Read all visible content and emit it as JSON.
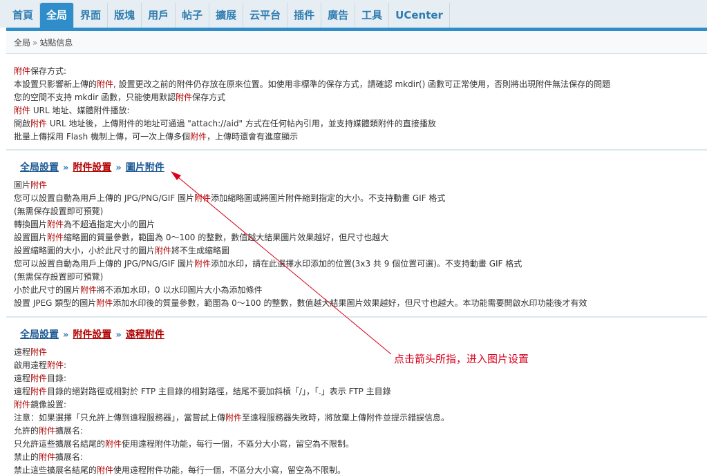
{
  "nav": {
    "tabs": [
      "首頁",
      "全局",
      "界面",
      "版塊",
      "用戶",
      "帖子",
      "擴展",
      "云平台",
      "插件",
      "廣告",
      "工具",
      "UCenter"
    ],
    "active": "全局"
  },
  "breadcrumb": {
    "root": "全局",
    "sep": "»",
    "current": "站點信息"
  },
  "colors": {
    "accent": "#2f8ec9",
    "highlight": "#b00000",
    "annotation": "#d9001b",
    "link": "#1d5a94"
  },
  "top_lines": {
    "l1": {
      "a": "附件",
      "b": "保存方式:"
    },
    "l2": {
      "a": "本設置只影響新上傳的",
      "b": "附件",
      "c": ", 設置更改之前的附件仍存放在原來位置。如使用非標準的保存方式，請確認 mkdir() 函數可正常使用，否則將出現附件無法保存的問題"
    },
    "l3": {
      "a": "您的空間不支持 mkdir 函數，只能使用默認",
      "b": "附件",
      "c": "保存方式"
    },
    "l4": {
      "a": "附件",
      "b": " URL 地址、媒體附件播放:"
    },
    "l5": {
      "a": "開啟",
      "b": "附件",
      "c": " URL 地址後，上傳附件的地址可通過 \"attach://aid\" 方式在任何帖內引用，並支持媒體類附件的直接播放"
    },
    "l6": {
      "a": "批量上傳採用 Flash 機制上傳，可一次上傳多個",
      "b": "附件",
      "c": "，上傳時還會有進度顯示"
    }
  },
  "section_image": {
    "crumb1": "全局設置",
    "crumb2": "附件設置",
    "crumb3": "圖片附件",
    "l1": {
      "a": "圖片",
      "b": "附件"
    },
    "l2": {
      "a": "您可以設置自動為用戶上傳的 JPG/PNG/GIF 圖片",
      "b": "附件",
      "c": "添加縮略圖或將圖片附件縮到指定的大小。不支持動畫 GIF 格式"
    },
    "l3": "(無需保存設置即可預覽)",
    "l4": {
      "a": "轉換圖片",
      "b": "附件",
      "c": "為不超過指定大小的圖片"
    },
    "l5": {
      "a": "設置圖片",
      "b": "附件",
      "c": "縮略圖的質量參數，範圍為 0～100 的整數，數值越大結果圖片效果越好，但尺寸也越大"
    },
    "l6": {
      "a": "設置縮略圖的大小，小於此尺寸的圖片",
      "b": "附件",
      "c": "將不生成縮略圖"
    },
    "l7": {
      "a": "您可以設置自動為用戶上傳的 JPG/PNG/GIF 圖片",
      "b": "附件",
      "c": "添加水印，請在此選擇水印添加的位置(3x3 共 9 個位置可選)。不支持動畫 GIF 格式"
    },
    "l8": "(無需保存設置即可預覽)",
    "l9": {
      "a": "小於此尺寸的圖片",
      "b": "附件",
      "c": "將不添加水印，0 以水印圖片大小為添加條件"
    },
    "l10": {
      "a": "設置 JPEG 類型的圖片",
      "b": "附件",
      "c": "添加水印後的質量參數，範圍為 0～100 的整數，數值越大結果圖片效果越好，但尺寸也越大。本功能需要開啟水印功能後才有效"
    }
  },
  "section_remote": {
    "crumb1": "全局設置",
    "crumb2": "附件設置",
    "crumb3": "遠程附件",
    "l1": {
      "a": "遠程",
      "b": "附件"
    },
    "l2": {
      "a": "啟用遠程",
      "b": "附件",
      "c": ":"
    },
    "l3": {
      "a": "遠程",
      "b": "附件",
      "c": "目錄:"
    },
    "l4": {
      "a": "遠程",
      "b": "附件",
      "c": "目錄的絕對路徑或相對於 FTP 主目錄的相對路徑，結尾不要加斜槓「/」，「.」表示 FTP 主目錄"
    },
    "l5": {
      "a": "附件",
      "b": "鏡像設置:"
    },
    "l6": {
      "a": "注意：如果選擇「只允許上傳到遠程服務器」，當嘗試上傳",
      "b": "附件",
      "c": "至遠程服務器失敗時，將放棄上傳附件並提示錯誤信息。"
    },
    "l7": {
      "a": "允許的",
      "b": "附件",
      "c": "擴展名:"
    },
    "l8": {
      "a": "只允許這些擴展名結尾的",
      "b": "附件",
      "c": "使用遠程附件功能，每行一個，不區分大小寫，留空為不限制。"
    },
    "l9": {
      "a": "禁止的",
      "b": "附件",
      "c": "擴展名:"
    },
    "l10": {
      "a": "禁止這些擴展名結尾的",
      "b": "附件",
      "c": "使用遠程附件功能，每行一個，不區分大小寫，留空為不限制。"
    }
  },
  "annotation": "点击箭头所指，进入图片设置"
}
